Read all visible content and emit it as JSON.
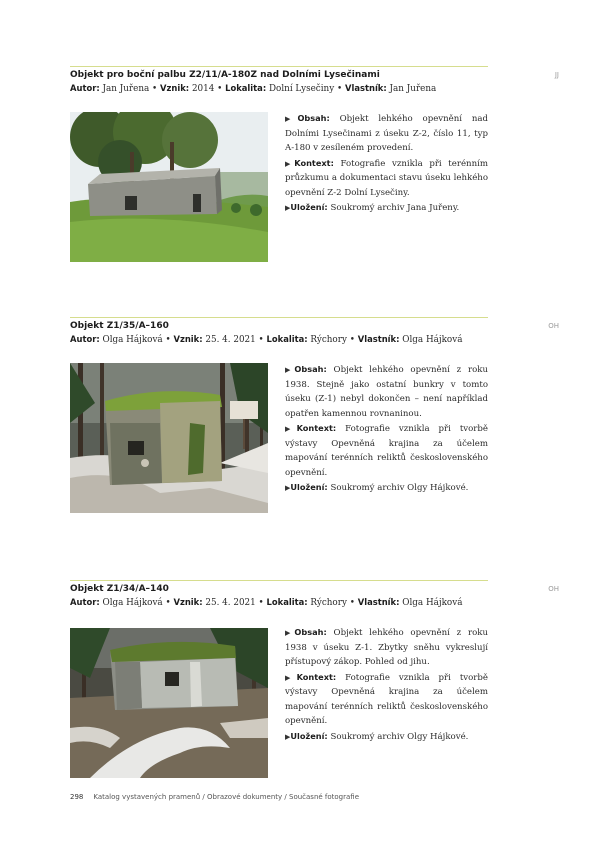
{
  "entries": [
    {
      "code": "JJ",
      "title": "Objekt pro boční palbu Z2/11/A-180Z nad Dolními Lysečinami",
      "meta": {
        "author_label": "Autor:",
        "author": "Jan Juřena",
        "origin_label": "Vznik:",
        "origin": "2014",
        "locality_label": "Lokalita:",
        "locality": "Dolní Lysečiny",
        "owner_label": "Vlastník:",
        "owner": "Jan Juřena",
        "sep": "•"
      },
      "photo": {
        "subject": "bunker-meadow-photo"
      },
      "content_label": "Obsah:",
      "content": "Objekt lehkého opevnění nad Dolními Lysečinami z úseku Z-2, číslo 11, typ A-180 v zesíleném provedení.",
      "context_label": "Kontext:",
      "context": "Fotografie vznikla při terénním průzkumu a dokumentaci stavu úseku lehkého opevnění Z-2 Dolní Lysečiny.",
      "storage_label": "Uložení:",
      "storage": "Soukromý archiv Jana Juřeny."
    },
    {
      "code": "OH",
      "title": "Objekt Z1/35/A–160",
      "meta": {
        "author_label": "Autor:",
        "author": "Olga Hájková",
        "origin_label": "Vznik:",
        "origin": "25. 4. 2021",
        "locality_label": "Lokalita:",
        "locality": "Rýchory",
        "owner_label": "Vlastník:",
        "owner": "Olga Hájková",
        "sep": "•"
      },
      "photo": {
        "subject": "bunker-forest-photo"
      },
      "content_label": "Obsah:",
      "content": "Objekt lehkého opevnění z roku 1938. Stejně jako ostatní bunkry v tomto úseku (Z-1) nebyl dokončen – není například opatřen kamennou rovnaninou.",
      "context_label": "Kontext:",
      "context": "Fotografie vznikla při tvorbě výstavy Opevněná krajina za účelem mapování terénních reliktů československého opevnění.",
      "storage_label": "Uložení:",
      "storage": "Soukromý archiv Olgy Hájkové."
    },
    {
      "code": "OH",
      "title": "Objekt Z1/34/A–140",
      "meta": {
        "author_label": "Autor:",
        "author": "Olga Hájková",
        "origin_label": "Vznik:",
        "origin": "25. 4. 2021",
        "locality_label": "Lokalita:",
        "locality": "Rýchory",
        "owner_label": "Vlastník:",
        "owner": "Olga Hájková",
        "sep": "•"
      },
      "photo": {
        "subject": "bunker-snow-photo"
      },
      "content_label": "Obsah:",
      "content": "Objekt lehkého opevnění z roku 1938 v úseku Z-1. Zbytky sněhu vykreslují přístupový zákop. Pohled od jihu.",
      "context_label": "Kontext:",
      "context": "Fotografie vznikla při tvorbě výstavy Opevněná krajina za účelem mapování terénních reliktů československého opevnění.",
      "storage_label": "Uložení:",
      "storage": "Soukromý archiv Olgy Hájkové."
    }
  ],
  "footer": {
    "page_number": "298",
    "breadcrumb": "Katalog vystavených pramenů / Obrazové dokumenty / Současné fotografie"
  },
  "colors": {
    "rule": "#d6dd8e",
    "text": "#2b2b2b"
  }
}
